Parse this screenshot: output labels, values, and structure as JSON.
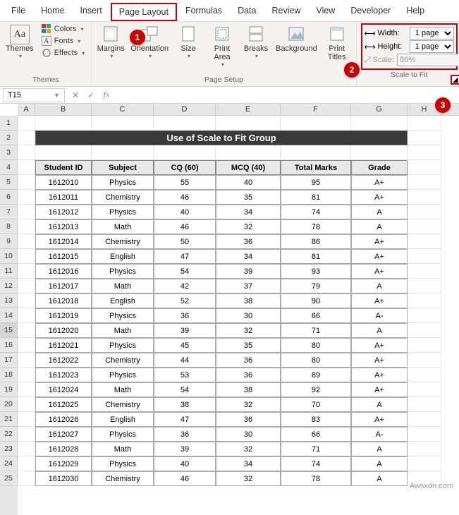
{
  "tabs": [
    "File",
    "Home",
    "Insert",
    "Page Layout",
    "Formulas",
    "Data",
    "Review",
    "View",
    "Developer",
    "Help"
  ],
  "active_tab": "Page Layout",
  "themes_group": {
    "label": "Themes",
    "themes": "Themes",
    "colors": "Colors",
    "fonts": "Fonts",
    "effects": "Effects"
  },
  "page_setup_group": {
    "label": "Page Setup",
    "margins": "Margins",
    "orientation": "Orientation",
    "size": "Size",
    "print_area": "Print\nArea",
    "breaks": "Breaks",
    "background": "Background",
    "print_titles": "Print\nTitles"
  },
  "scale_group": {
    "label": "Scale to Fit",
    "width_lbl": "Width:",
    "height_lbl": "Height:",
    "scale_lbl": "Scale:",
    "width_val": "1 page",
    "height_val": "1 page",
    "scale_val": "86%"
  },
  "callouts": {
    "one": "1",
    "two": "2",
    "three": "3"
  },
  "namebox": "T15",
  "formula": "",
  "title": "Use of Scale to Fit Group",
  "headers": [
    "Student ID",
    "Subject",
    "CQ  (60)",
    "MCQ  (40)",
    "Total Marks",
    "Grade"
  ],
  "col_letters": [
    "A",
    "B",
    "C",
    "D",
    "E",
    "F",
    "G",
    "H"
  ],
  "rows": [
    {
      "id": "1612010",
      "subj": "Physics",
      "cq": "55",
      "mcq": "40",
      "tot": "95",
      "gr": "A+"
    },
    {
      "id": "1612011",
      "subj": "Chemistry",
      "cq": "46",
      "mcq": "35",
      "tot": "81",
      "gr": "A+"
    },
    {
      "id": "1612012",
      "subj": "Physics",
      "cq": "40",
      "mcq": "34",
      "tot": "74",
      "gr": "A"
    },
    {
      "id": "1612013",
      "subj": "Math",
      "cq": "46",
      "mcq": "32",
      "tot": "78",
      "gr": "A"
    },
    {
      "id": "1612014",
      "subj": "Chemistry",
      "cq": "50",
      "mcq": "36",
      "tot": "86",
      "gr": "A+"
    },
    {
      "id": "1612015",
      "subj": "English",
      "cq": "47",
      "mcq": "34",
      "tot": "81",
      "gr": "A+"
    },
    {
      "id": "1612016",
      "subj": "Physics",
      "cq": "54",
      "mcq": "39",
      "tot": "93",
      "gr": "A+"
    },
    {
      "id": "1612017",
      "subj": "Math",
      "cq": "42",
      "mcq": "37",
      "tot": "79",
      "gr": "A"
    },
    {
      "id": "1612018",
      "subj": "English",
      "cq": "52",
      "mcq": "38",
      "tot": "90",
      "gr": "A+"
    },
    {
      "id": "1612019",
      "subj": "Physics",
      "cq": "36",
      "mcq": "30",
      "tot": "66",
      "gr": "A-"
    },
    {
      "id": "1612020",
      "subj": "Math",
      "cq": "39",
      "mcq": "32",
      "tot": "71",
      "gr": "A"
    },
    {
      "id": "1612021",
      "subj": "Physics",
      "cq": "45",
      "mcq": "35",
      "tot": "80",
      "gr": "A+"
    },
    {
      "id": "1612022",
      "subj": "Chemistry",
      "cq": "44",
      "mcq": "36",
      "tot": "80",
      "gr": "A+"
    },
    {
      "id": "1612023",
      "subj": "Physics",
      "cq": "53",
      "mcq": "36",
      "tot": "89",
      "gr": "A+"
    },
    {
      "id": "1612024",
      "subj": "Math",
      "cq": "54",
      "mcq": "38",
      "tot": "92",
      "gr": "A+"
    },
    {
      "id": "1612025",
      "subj": "Chemistry",
      "cq": "38",
      "mcq": "32",
      "tot": "70",
      "gr": "A"
    },
    {
      "id": "1612026",
      "subj": "English",
      "cq": "47",
      "mcq": "36",
      "tot": "83",
      "gr": "A+"
    },
    {
      "id": "1612027",
      "subj": "Physics",
      "cq": "36",
      "mcq": "30",
      "tot": "66",
      "gr": "A-"
    },
    {
      "id": "1612028",
      "subj": "Math",
      "cq": "39",
      "mcq": "32",
      "tot": "71",
      "gr": "A"
    },
    {
      "id": "1612029",
      "subj": "Physics",
      "cq": "40",
      "mcq": "34",
      "tot": "74",
      "gr": "A"
    },
    {
      "id": "1612030",
      "subj": "Chemistry",
      "cq": "46",
      "mcq": "32",
      "tot": "78",
      "gr": "A"
    }
  ],
  "watermark": "Awsxdn.com"
}
